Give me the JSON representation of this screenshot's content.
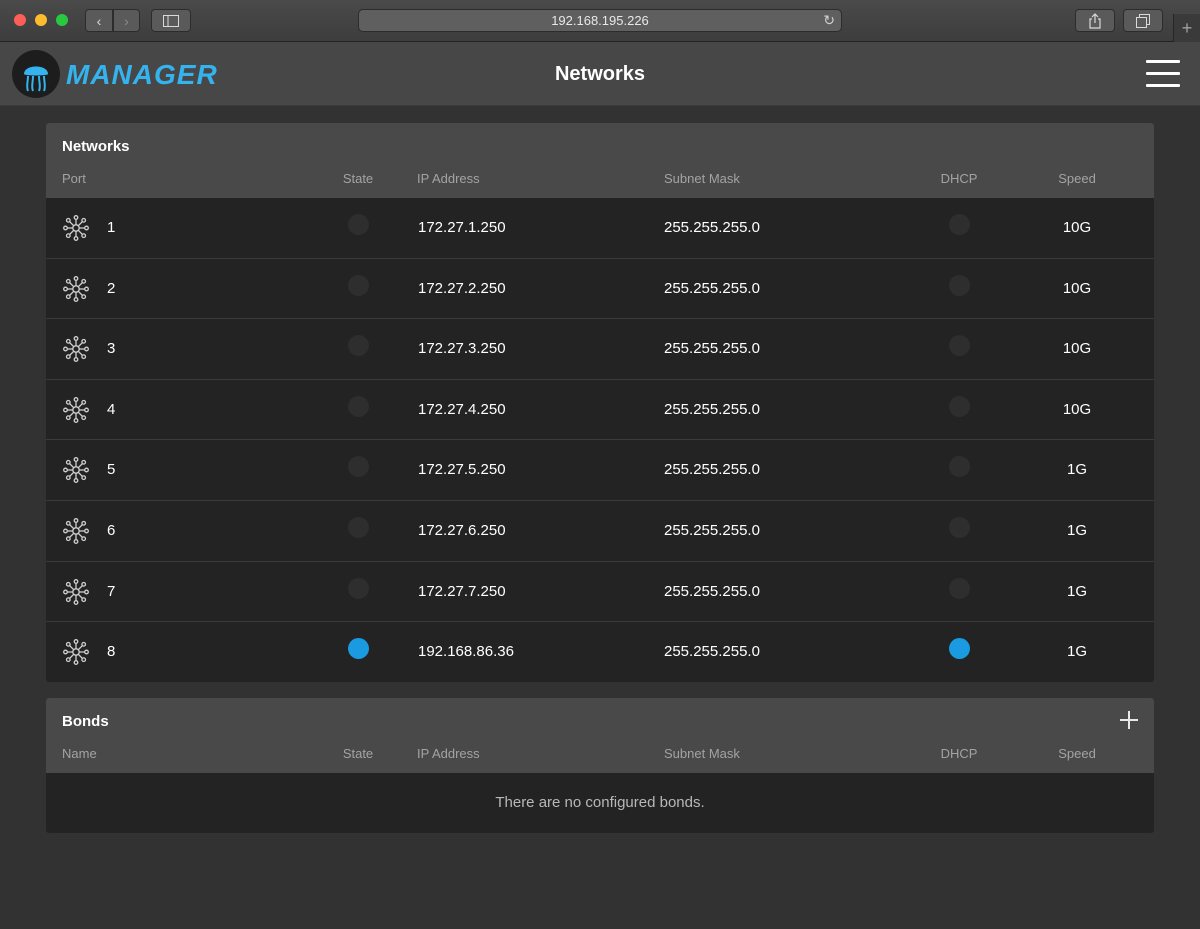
{
  "browser": {
    "url": "192.168.195.226"
  },
  "app": {
    "logo_text": "MANAGER",
    "title": "Networks",
    "accent": "#35b3ee"
  },
  "networks": {
    "title": "Networks",
    "columns": {
      "port": "Port",
      "state": "State",
      "ip": "IP Address",
      "mask": "Subnet Mask",
      "dhcp": "DHCP",
      "speed": "Speed"
    },
    "rows": [
      {
        "port": "1",
        "state": false,
        "ip": "172.27.1.250",
        "mask": "255.255.255.0",
        "dhcp": false,
        "speed": "10G"
      },
      {
        "port": "2",
        "state": false,
        "ip": "172.27.2.250",
        "mask": "255.255.255.0",
        "dhcp": false,
        "speed": "10G"
      },
      {
        "port": "3",
        "state": false,
        "ip": "172.27.3.250",
        "mask": "255.255.255.0",
        "dhcp": false,
        "speed": "10G"
      },
      {
        "port": "4",
        "state": false,
        "ip": "172.27.4.250",
        "mask": "255.255.255.0",
        "dhcp": false,
        "speed": "10G"
      },
      {
        "port": "5",
        "state": false,
        "ip": "172.27.5.250",
        "mask": "255.255.255.0",
        "dhcp": false,
        "speed": "1G"
      },
      {
        "port": "6",
        "state": false,
        "ip": "172.27.6.250",
        "mask": "255.255.255.0",
        "dhcp": false,
        "speed": "1G"
      },
      {
        "port": "7",
        "state": false,
        "ip": "172.27.7.250",
        "mask": "255.255.255.0",
        "dhcp": false,
        "speed": "1G"
      },
      {
        "port": "8",
        "state": true,
        "ip": "192.168.86.36",
        "mask": "255.255.255.0",
        "dhcp": true,
        "speed": "1G"
      }
    ],
    "active_color": "#1a9ae0",
    "port_icon": "network-port-icon"
  },
  "bonds": {
    "title": "Bonds",
    "columns": {
      "name": "Name",
      "state": "State",
      "ip": "IP Address",
      "mask": "Subnet Mask",
      "dhcp": "DHCP",
      "speed": "Speed"
    },
    "empty_message": "There are no configured bonds.",
    "add_icon": "plus-icon"
  }
}
